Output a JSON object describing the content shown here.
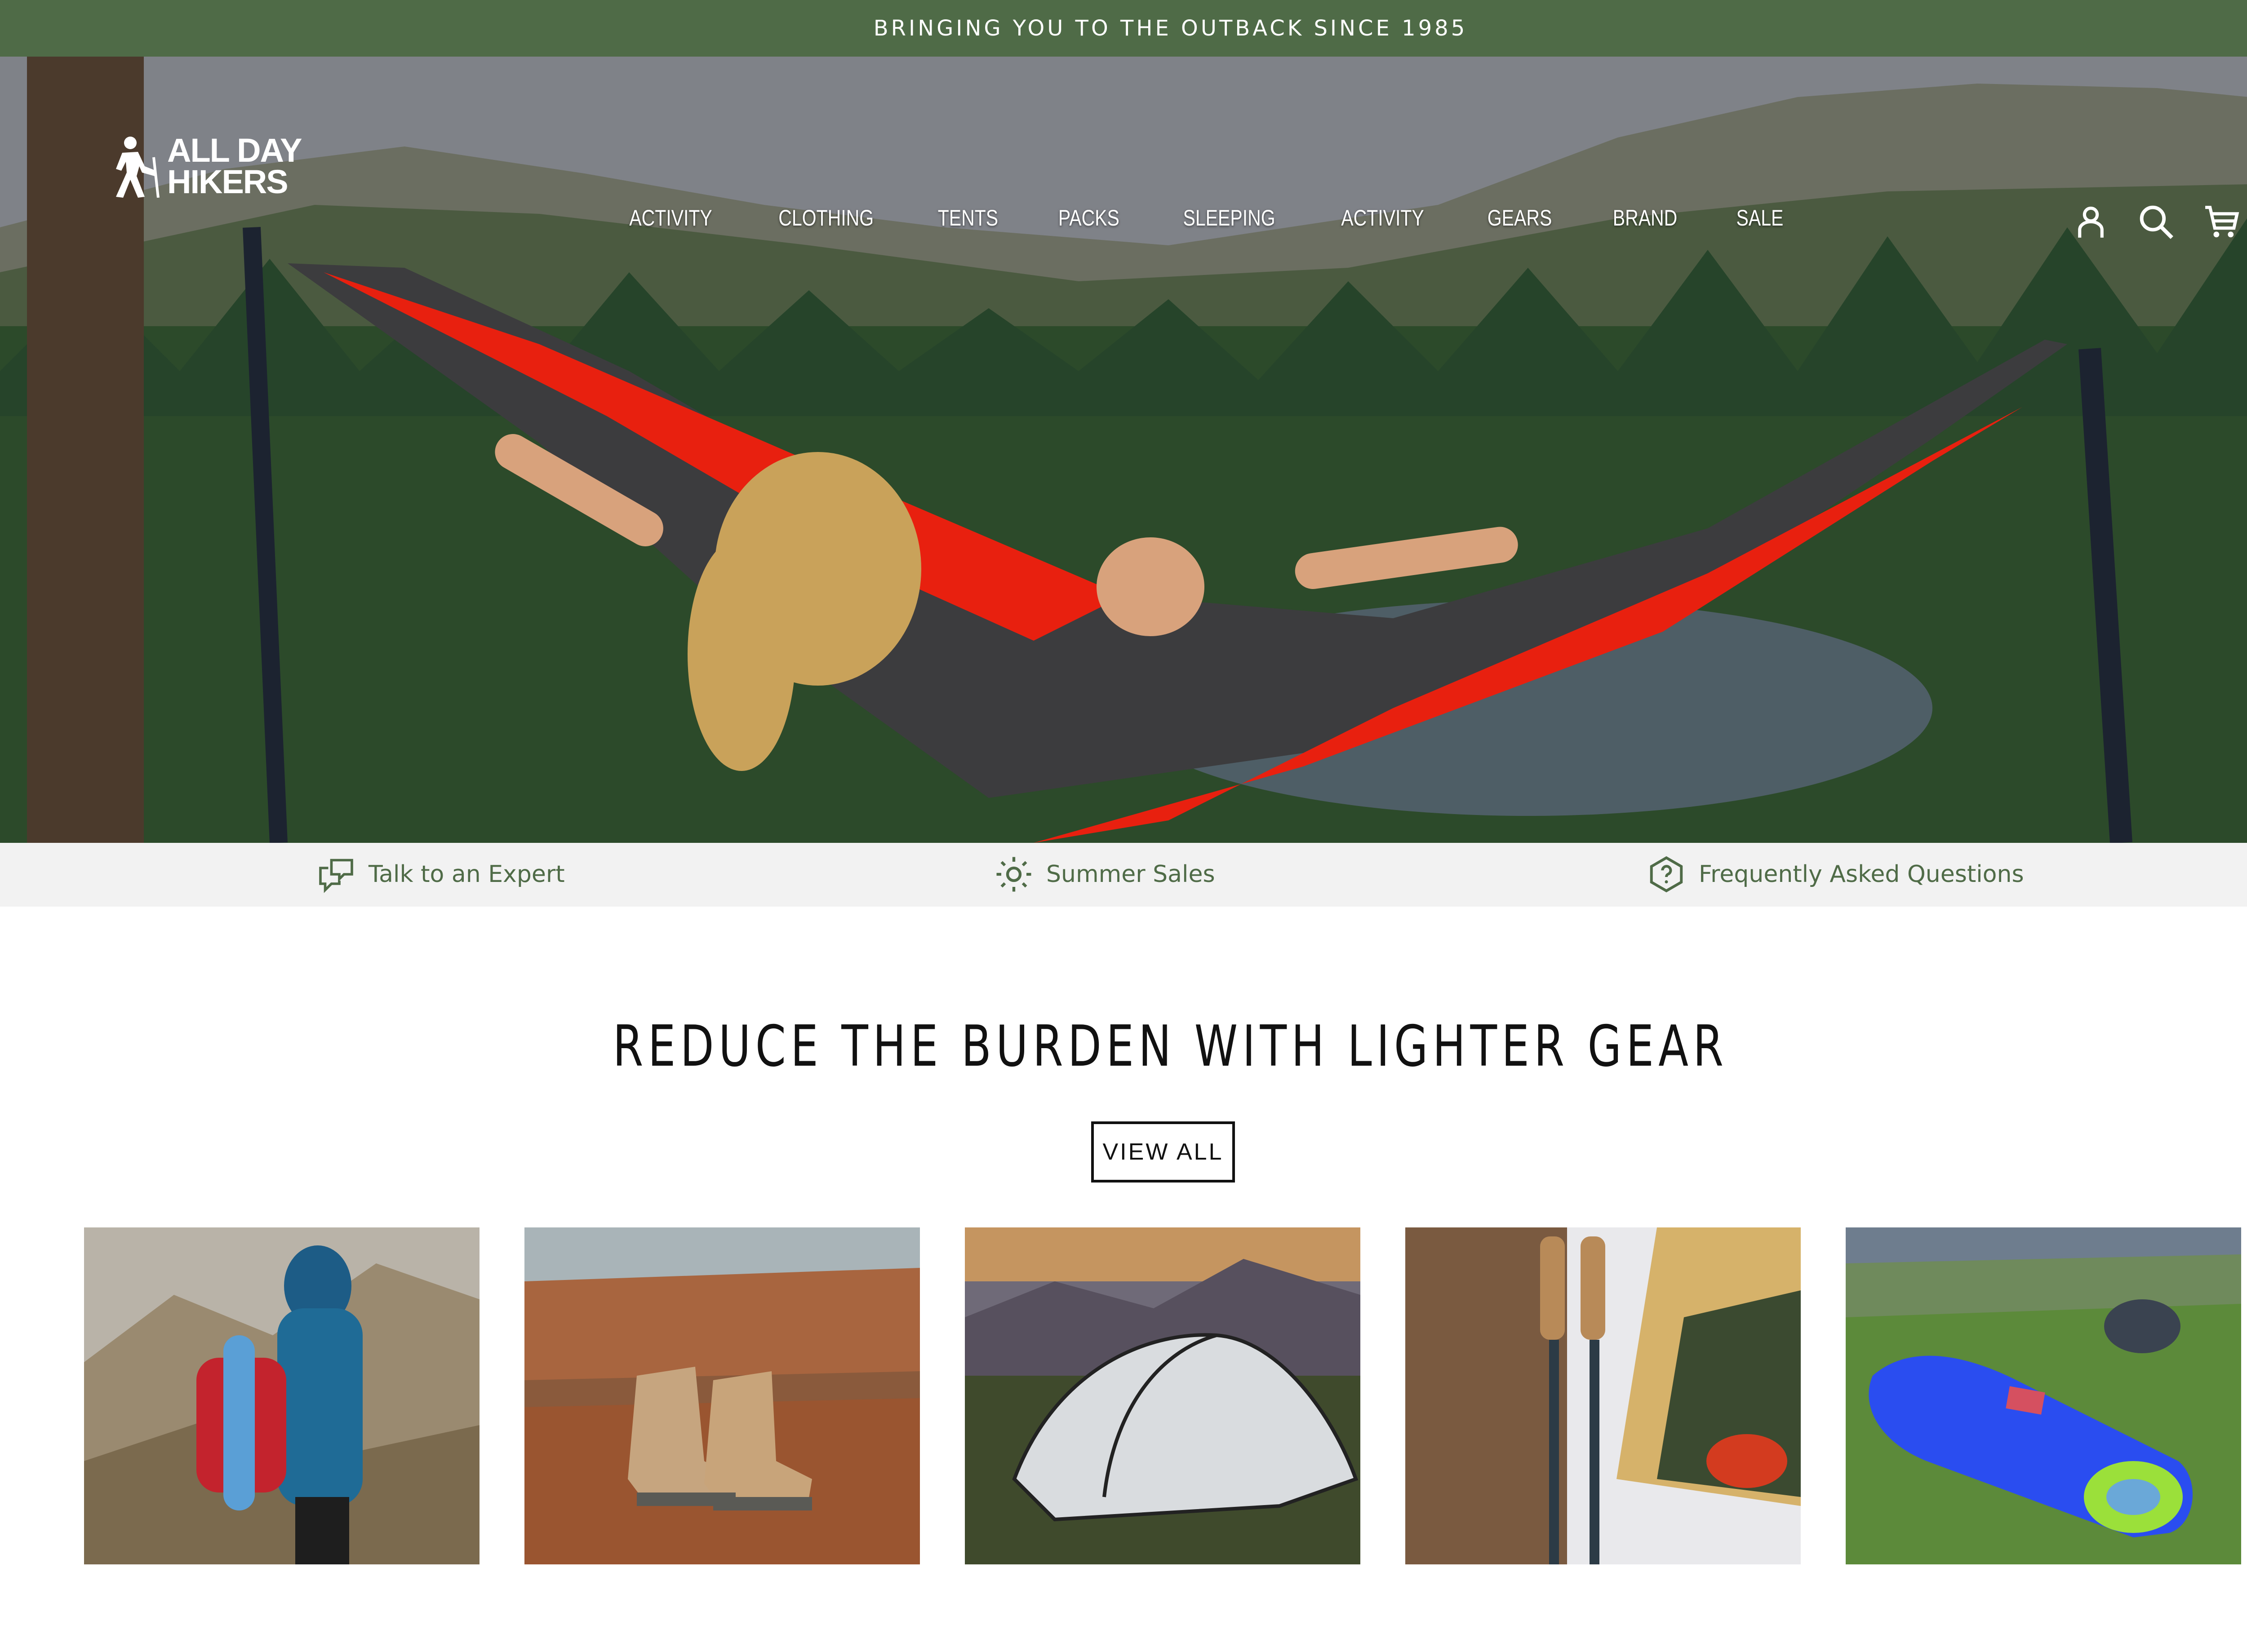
{
  "announcement": {
    "text": "BRINGING YOU TO THE OUTBACK SINCE 1985"
  },
  "header": {
    "logo": {
      "line1": "ALL DAY",
      "line2": "HIKERS"
    },
    "nav": [
      {
        "label": "ACTIVITY"
      },
      {
        "label": "CLOTHING"
      },
      {
        "label": "TENTS"
      },
      {
        "label": "PACKS"
      },
      {
        "label": "SLEEPING"
      },
      {
        "label": "ACTIVITY"
      },
      {
        "label": "GEARS"
      },
      {
        "label": "BRAND"
      },
      {
        "label": "SALE"
      }
    ],
    "icons": [
      "account-icon",
      "search-icon",
      "cart-icon"
    ]
  },
  "info_strip": [
    {
      "label": "Talk to an Expert",
      "icon": "chat-icon"
    },
    {
      "label": "Summer Sales",
      "icon": "sun-icon"
    },
    {
      "label": "Frequently Asked Questions",
      "icon": "question-icon"
    }
  ],
  "section": {
    "title": "REDUCE THE BURDEN WITH LIGHTER GEAR",
    "view_all_label": "VIEW ALL"
  },
  "products": [
    {
      "image": "hiker-with-backpack"
    },
    {
      "image": "hiking-boots"
    },
    {
      "image": "tent"
    },
    {
      "image": "trekking-poles"
    },
    {
      "image": "sleeping-bag"
    }
  ],
  "colors": {
    "brand_green": "#4f6b47",
    "strip_background": "#f2f2f2",
    "text_dark": "#111111"
  }
}
